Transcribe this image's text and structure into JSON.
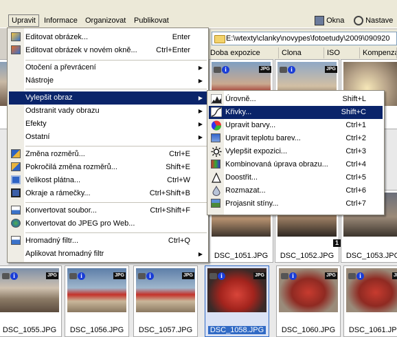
{
  "menubar": {
    "items": [
      "Upravit",
      "Informace",
      "Organizovat",
      "Publikovat"
    ],
    "right": [
      "Okna",
      "Nastave"
    ]
  },
  "path": {
    "value": "E:\\wtexty\\clanky\\novypes\\fotoetudy\\2009\\090920"
  },
  "columns": [
    "Doba expozice",
    "Clona",
    "ISO",
    "Kompenzace"
  ],
  "edit_menu": [
    {
      "label": "Editovat obrázek...",
      "shortcut": "Enter"
    },
    {
      "label": "Editovat obrázek v novém okně...",
      "shortcut": "Ctrl+Enter"
    },
    {
      "label": "Otočení a převrácení",
      "shortcut": ""
    },
    {
      "label": "Nástroje",
      "shortcut": ""
    },
    {
      "label": "Vylepšit obraz",
      "shortcut": ""
    },
    {
      "label": "Odstranit vady obrazu",
      "shortcut": ""
    },
    {
      "label": "Efekty",
      "shortcut": ""
    },
    {
      "label": "Ostatní",
      "shortcut": ""
    },
    {
      "label": "Změna rozměrů...",
      "shortcut": "Ctrl+E"
    },
    {
      "label": "Pokročilá změna rozměrů...",
      "shortcut": "Shift+E"
    },
    {
      "label": "Velikost plátna...",
      "shortcut": "Ctrl+W"
    },
    {
      "label": "Okraje a rámečky...",
      "shortcut": "Ctrl+Shift+B"
    },
    {
      "label": "Konvertovat soubor...",
      "shortcut": "Ctrl+Shift+F"
    },
    {
      "label": "Konvertovat do JPEG pro Web...",
      "shortcut": ""
    },
    {
      "label": "Hromadný filtr...",
      "shortcut": "Ctrl+Q"
    },
    {
      "label": "Aplikovat hromadný filtr",
      "shortcut": ""
    }
  ],
  "enhance_menu": [
    {
      "label": "Úrovně...",
      "shortcut": "Shift+L"
    },
    {
      "label": "Křivky...",
      "shortcut": "Shift+C"
    },
    {
      "label": "Upravit barvy...",
      "shortcut": "Ctrl+1"
    },
    {
      "label": "Upravit teplotu barev...",
      "shortcut": "Ctrl+2"
    },
    {
      "label": "Vylepšit expozici...",
      "shortcut": "Ctrl+3"
    },
    {
      "label": "Kombinovaná úprava obrazu...",
      "shortcut": "Ctrl+4"
    },
    {
      "label": "Doostřit...",
      "shortcut": "Ctrl+5"
    },
    {
      "label": "Rozmazat...",
      "shortcut": "Ctrl+6"
    },
    {
      "label": "Projasnit stíny...",
      "shortcut": "Ctrl+7"
    }
  ],
  "thumbs": {
    "row2": [
      "DSC_1051.JPG",
      "DSC_1052.JPG",
      "DSC_1053.JPG"
    ],
    "row3": [
      "DSC_1055.JPG",
      "DSC_1056.JPG",
      "DSC_1057.JPG",
      "DSC_1058.JPG",
      "DSC_1060.JPG",
      "DSC_1061.JPG"
    ],
    "badge_jpg": "JPG",
    "badge_info": "i",
    "badge_num": "1"
  }
}
